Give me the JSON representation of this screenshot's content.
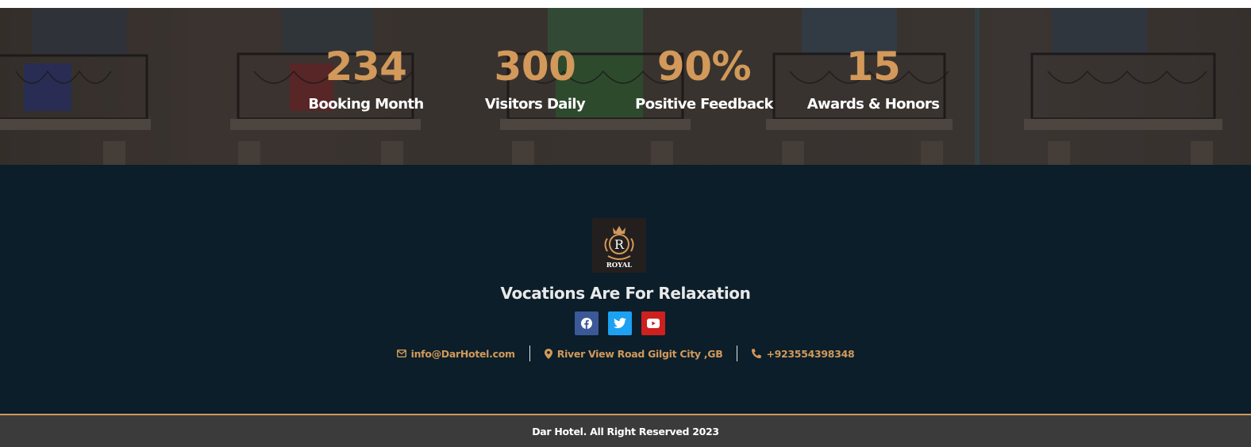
{
  "stats": [
    {
      "value": "234",
      "label": "Booking Month"
    },
    {
      "value": "300",
      "label": "Visitors Daily"
    },
    {
      "value": "90%",
      "label": "Positive Feedback"
    },
    {
      "value": "15",
      "label": "Awards & Honors"
    }
  ],
  "footer": {
    "logo_text": "ROYAL",
    "logo_letter": "R",
    "tagline": "Vocations Are For Relaxation",
    "social": [
      "facebook-icon",
      "twitter-icon",
      "youtube-icon"
    ],
    "contacts": {
      "email": "info@DarHotel.com",
      "address": "River View Road Gilgit City ,GB",
      "phone": "+923554398348"
    },
    "copyright": "Dar Hotel. All Right Reserved 2023"
  },
  "colors": {
    "accent": "#d2995a",
    "footer_bg": "#0b1e29",
    "copyright_bg": "#3b3b3b",
    "facebook": "#3b5998",
    "twitter": "#1da1f2",
    "youtube": "#cd201f"
  }
}
